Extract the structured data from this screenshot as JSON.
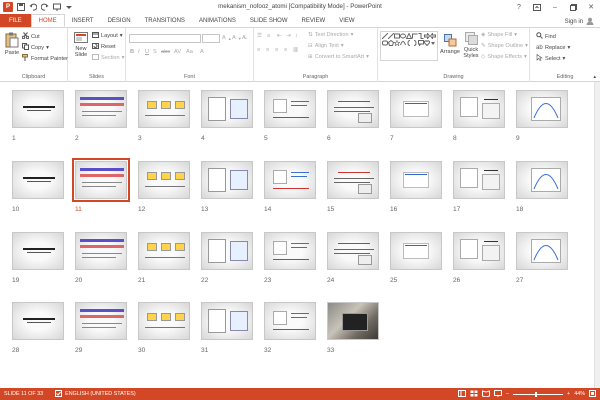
{
  "window": {
    "title": "mekanism_nofooz_atomi [Compatibility Mode] - PowerPoint"
  },
  "tabs": [
    {
      "label": "FILE"
    },
    {
      "label": "HOME"
    },
    {
      "label": "INSERT"
    },
    {
      "label": "DESIGN"
    },
    {
      "label": "TRANSITIONS"
    },
    {
      "label": "ANIMATIONS"
    },
    {
      "label": "SLIDE SHOW"
    },
    {
      "label": "REVIEW"
    },
    {
      "label": "VIEW"
    }
  ],
  "signin": "Sign in",
  "ribbon": {
    "clipboard": {
      "paste": "Paste",
      "cut": "Cut",
      "copy": "Copy",
      "format_painter": "Format Painter",
      "label": "Clipboard"
    },
    "slides": {
      "new_slide": "New",
      "new_slide2": "Slide",
      "layout": "Layout",
      "reset": "Reset",
      "section": "Section",
      "label": "Slides"
    },
    "font": {
      "label": "Font"
    },
    "paragraph": {
      "text_direction": "Text Direction",
      "align_text": "Align Text",
      "smartart": "Convert to SmartArt",
      "label": "Paragraph"
    },
    "drawing": {
      "arrange": "Arrange",
      "quick_styles": "Quick",
      "quick_styles2": "Styles",
      "shape_fill": "Shape Fill",
      "shape_outline": "Shape Outline",
      "shape_effects": "Shape Effects",
      "label": "Drawing"
    },
    "editing": {
      "find": "Find",
      "replace": "Replace",
      "select": "Select",
      "label": "Editing"
    }
  },
  "slides": [
    {
      "n": "1"
    },
    {
      "n": "2"
    },
    {
      "n": "3"
    },
    {
      "n": "4"
    },
    {
      "n": "5"
    },
    {
      "n": "6"
    },
    {
      "n": "7"
    },
    {
      "n": "8"
    },
    {
      "n": "9"
    },
    {
      "n": "10"
    },
    {
      "n": "11"
    },
    {
      "n": "12"
    },
    {
      "n": "13"
    },
    {
      "n": "14"
    },
    {
      "n": "15"
    },
    {
      "n": "16"
    },
    {
      "n": "17"
    },
    {
      "n": "18"
    },
    {
      "n": "19"
    },
    {
      "n": "20"
    },
    {
      "n": "21"
    },
    {
      "n": "22"
    },
    {
      "n": "23"
    },
    {
      "n": "24"
    },
    {
      "n": "25"
    },
    {
      "n": "26"
    },
    {
      "n": "27"
    },
    {
      "n": "28"
    },
    {
      "n": "29"
    },
    {
      "n": "30"
    },
    {
      "n": "31"
    },
    {
      "n": "32"
    },
    {
      "n": "33"
    }
  ],
  "selected_slide": "11",
  "status": {
    "slide": "SLIDE 11 OF 33",
    "language": "ENGLISH (UNITED STATES)",
    "zoom": "44%"
  },
  "colors": {
    "accent": "#d24726"
  }
}
